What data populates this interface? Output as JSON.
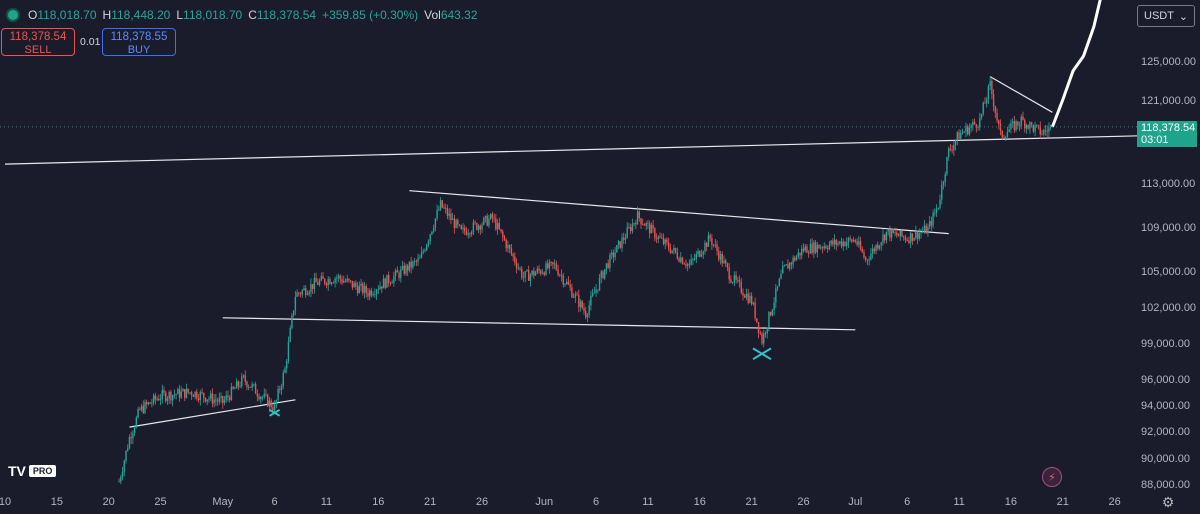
{
  "ohlc": {
    "open_label": "O",
    "open": "118,018.70",
    "high_label": "H",
    "high": "118,448.20",
    "low_label": "L",
    "low": "118,018.70",
    "close_label": "C",
    "close": "118,378.54",
    "change": "+359.85 (+0.30%)",
    "vol_label": "Vol",
    "vol": "643.32"
  },
  "trade": {
    "sell_price": "118,378.54",
    "sell_label": "SELL",
    "spread": "0.01",
    "buy_price": "118,378.55",
    "buy_label": "BUY"
  },
  "currency": {
    "label": "USDT",
    "icon": "chevron-down-icon"
  },
  "last_price": {
    "value": "118,378.54",
    "countdown": "03:01"
  },
  "brand": {
    "logo": "TV",
    "badge": "PRO"
  },
  "colors": {
    "up": "#26a69a",
    "down": "#ef5350",
    "background": "#1b1c2b",
    "tag": "#1fa38a",
    "accent_mark": "#2ec4c9"
  },
  "icons": {
    "flash": "flash-icon",
    "settings": "gear-icon"
  },
  "chart_data": {
    "type": "candlestick",
    "y_ticks": [
      {
        "value": 88000,
        "label": "88,000.00"
      },
      {
        "value": 90000,
        "label": "90,000.00"
      },
      {
        "value": 92000,
        "label": "92,000.00"
      },
      {
        "value": 94000,
        "label": "94,000.00"
      },
      {
        "value": 96000,
        "label": "96,000.00"
      },
      {
        "value": 99000,
        "label": "99,000.00"
      },
      {
        "value": 102000,
        "label": "102,000.00"
      },
      {
        "value": 105000,
        "label": "105,000.00"
      },
      {
        "value": 109000,
        "label": "109,000.00"
      },
      {
        "value": 113000,
        "label": "113,000.00"
      },
      {
        "value": 117000,
        "label": "117,000.00"
      },
      {
        "value": 121000,
        "label": "121,000.00"
      },
      {
        "value": 125000,
        "label": "125,000.00"
      }
    ],
    "x_ticks": [
      "10",
      "15",
      "20",
      "25",
      "May",
      "6",
      "11",
      "16",
      "21",
      "26",
      "Jun",
      "6",
      "11",
      "16",
      "21",
      "26",
      "Jul",
      "6",
      "11",
      "16",
      "21",
      "26"
    ],
    "last_price_value": 118378.54,
    "series": [
      {
        "date": "Apr 21",
        "close": 88200
      },
      {
        "date": "Apr 22",
        "close": 91500
      },
      {
        "date": "Apr 23",
        "close": 93600
      },
      {
        "date": "Apr 25",
        "close": 94700
      },
      {
        "date": "Apr 28",
        "close": 95000
      },
      {
        "date": "May 1",
        "close": 94200
      },
      {
        "date": "May 3",
        "close": 96000
      },
      {
        "date": "May 5",
        "close": 94500
      },
      {
        "date": "May 6",
        "close": 93800
      },
      {
        "date": "May 7",
        "close": 96800
      },
      {
        "date": "May 8",
        "close": 103000
      },
      {
        "date": "May 10",
        "close": 104000
      },
      {
        "date": "May 12",
        "close": 104500
      },
      {
        "date": "May 15",
        "close": 103200
      },
      {
        "date": "May 18",
        "close": 104800
      },
      {
        "date": "May 20",
        "close": 106000
      },
      {
        "date": "May 22",
        "close": 111000
      },
      {
        "date": "May 24",
        "close": 108500
      },
      {
        "date": "May 27",
        "close": 109800
      },
      {
        "date": "May 30",
        "close": 104500
      },
      {
        "date": "Jun 2",
        "close": 105500
      },
      {
        "date": "Jun 5",
        "close": 101500
      },
      {
        "date": "Jun 7",
        "close": 105500
      },
      {
        "date": "Jun 10",
        "close": 110000
      },
      {
        "date": "Jun 12",
        "close": 108000
      },
      {
        "date": "Jun 15",
        "close": 105500
      },
      {
        "date": "Jun 17",
        "close": 108000
      },
      {
        "date": "Jun 19",
        "close": 104500
      },
      {
        "date": "Jun 21",
        "close": 102500
      },
      {
        "date": "Jun 22",
        "close": 99200
      },
      {
        "date": "Jun 24",
        "close": 105000
      },
      {
        "date": "Jun 26",
        "close": 107000
      },
      {
        "date": "Jun 29",
        "close": 107500
      },
      {
        "date": "Jul 1",
        "close": 107800
      },
      {
        "date": "Jul 2",
        "close": 106000
      },
      {
        "date": "Jul 4",
        "close": 108500
      },
      {
        "date": "Jul 6",
        "close": 108000
      },
      {
        "date": "Jul 8",
        "close": 108800
      },
      {
        "date": "Jul 9",
        "close": 111000
      },
      {
        "date": "Jul 10",
        "close": 116000
      },
      {
        "date": "Jul 11",
        "close": 117600
      },
      {
        "date": "Jul 13",
        "close": 119000
      },
      {
        "date": "Jul 14",
        "close": 122500
      },
      {
        "date": "Jul 15",
        "close": 117500
      },
      {
        "date": "Jul 17",
        "close": 119000
      },
      {
        "date": "Jul 19",
        "close": 117800
      },
      {
        "date": "Jul 20",
        "close": 118378.54
      }
    ],
    "projection": [
      {
        "date": "Jul 20",
        "value": 118378.54
      },
      {
        "date": "Jul 21",
        "value": 121000
      },
      {
        "date": "Jul 22",
        "value": 124000
      },
      {
        "date": "Jul 23",
        "value": 125500
      },
      {
        "date": "Jul 24",
        "value": 128500
      },
      {
        "date": "Jul 25",
        "value": 133000
      }
    ],
    "trendlines": [
      {
        "from": {
          "date": "Apr 10",
          "value": 114800
        },
        "to": {
          "date": "Aug 1",
          "value": 117600
        }
      },
      {
        "from": {
          "date": "May 19",
          "value": 112300
        },
        "to": {
          "date": "Jul 10",
          "value": 108400
        }
      },
      {
        "from": {
          "date": "May 1",
          "value": 101100
        },
        "to": {
          "date": "Jul 1",
          "value": 100100
        }
      },
      {
        "from": {
          "date": "Apr 22",
          "value": 92300
        },
        "to": {
          "date": "May 8",
          "value": 94400
        }
      },
      {
        "from": {
          "date": "Jul 14",
          "value": 123400
        },
        "to": {
          "date": "Jul 20",
          "value": 119800
        }
      }
    ],
    "markers": [
      {
        "type": "x",
        "date": "May 6",
        "value": 93400
      },
      {
        "type": "x",
        "date": "Jun 22",
        "value": 98100
      }
    ],
    "grid": false
  }
}
